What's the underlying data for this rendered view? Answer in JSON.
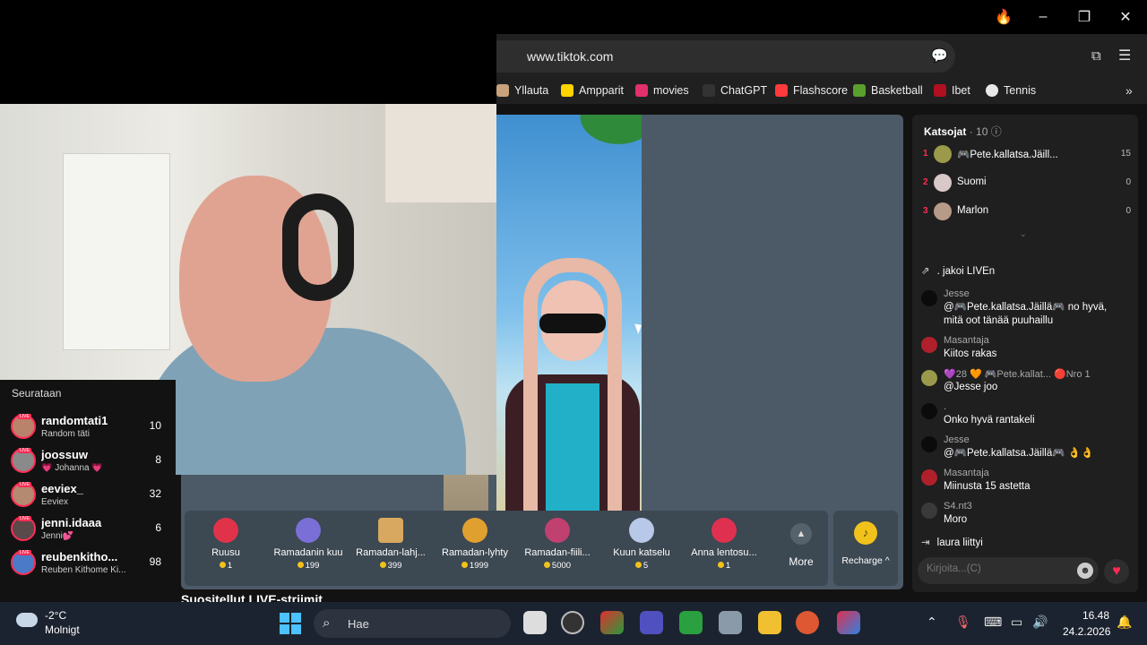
{
  "browser": {
    "url": "www.tiktok.com",
    "bookmarks": [
      {
        "label": "Yllauta",
        "icon": "yllauta-icon",
        "color": "#c8a27a"
      },
      {
        "label": "Ampparit",
        "icon": "ampparit-icon",
        "color": "#ffd400"
      },
      {
        "label": "movies",
        "icon": "heart-icon",
        "color": "#e1306c"
      },
      {
        "label": "ChatGPT",
        "icon": "chatgpt-icon",
        "color": "#333333"
      },
      {
        "label": "Flashscore",
        "icon": "flashscore-icon",
        "color": "#ff3a3a"
      },
      {
        "label": "Basketball",
        "icon": "basketball-icon",
        "color": "#5aa02c"
      },
      {
        "label": "Ibet",
        "icon": "ibet-icon",
        "color": "#b01020"
      },
      {
        "label": "Tennis",
        "icon": "tennis-icon",
        "color": "#e8e8e8"
      }
    ]
  },
  "following": {
    "header": "Seurataan",
    "items": [
      {
        "name": "randomtati1",
        "sub": "Random täti",
        "count": "10"
      },
      {
        "name": "joossuw",
        "sub": "💗 Johanna 💗",
        "count": "8"
      },
      {
        "name": "eeviex_",
        "sub": "Eeviex",
        "count": "32"
      },
      {
        "name": "jenni.idaaa",
        "sub": "Jenni💕",
        "count": "6"
      },
      {
        "name": "reubenkitho...",
        "sub": "Reuben Kithome Ki...",
        "count": "98"
      }
    ],
    "live_badge": "LIVE",
    "recommended": "Suositellut LIVE-striimit"
  },
  "gifts": [
    {
      "name": "Ruusu",
      "price": "1",
      "color": "#e0334a"
    },
    {
      "name": "Ramadanin kuu",
      "price": "199",
      "color": "#7a6fd6"
    },
    {
      "name": "Ramadan-lahj...",
      "price": "399",
      "color": "#d8a860"
    },
    {
      "name": "Ramadan-lyhty",
      "price": "1999",
      "color": "#e0a030"
    },
    {
      "name": "Ramadan-fiili...",
      "price": "5000",
      "color": "#c04070"
    },
    {
      "name": "Kuun katselu",
      "price": "5",
      "color": "#b8c8e8"
    },
    {
      "name": "Anna lentosu...",
      "price": "1",
      "color": "#e03050"
    }
  ],
  "more_label": "More",
  "recharge_label": "Recharge ^",
  "viewers": {
    "title": "Katsojat",
    "count": "· 10",
    "items": [
      {
        "rank": "1",
        "name": "🎮Pete.kallatsa.Jäill...",
        "score": "15"
      },
      {
        "rank": "2",
        "name": "Suomi",
        "score": "0"
      },
      {
        "rank": "3",
        "name": "Marlon",
        "score": "0"
      }
    ]
  },
  "chat": {
    "share_text": ".  jakoi LIVEn",
    "messages": [
      {
        "user": "Jesse",
        "text": "@🎮Pete.kallatsa.Jäillä🎮 no hyvä, mitä oot tänää puuhaillu"
      },
      {
        "user": "Masantaja",
        "text": "Kiitos rakas"
      },
      {
        "user": "💜28 🧡 🎮Pete.kallat... 🔴Nro 1",
        "text": "@Jesse joo"
      },
      {
        "user": ".",
        "text": "Onko hyvä rantakeli"
      },
      {
        "user": "Jesse",
        "text": "@🎮Pete.kallatsa.Jäillä🎮 👌👌"
      },
      {
        "user": "Masantaja",
        "text": "Miinusta 15 astetta"
      },
      {
        "user": "S4.nt3",
        "text": "Moro"
      }
    ],
    "join_text": "laura  liittyi",
    "input_placeholder": "Kirjoita...(C)"
  },
  "taskbar": {
    "temp": "-2°C",
    "weather": "Molnigt",
    "search": "Hae",
    "time": "16.48",
    "date": "24.2.2026"
  }
}
